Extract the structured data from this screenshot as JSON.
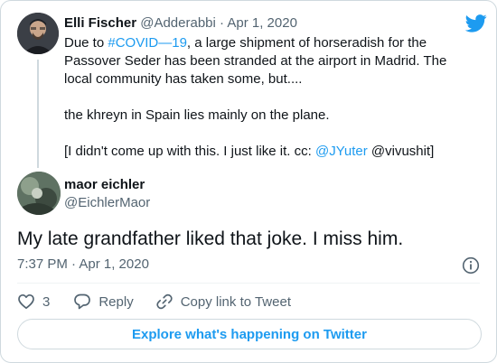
{
  "parent_tweet": {
    "author_name": "Elli Fischer",
    "author_handle": "@Adderabbi",
    "separator": "·",
    "date": "Apr 1, 2020",
    "line1_prefix": "Due to ",
    "hashtag": "#COVID—19",
    "line1_suffix": ", a large shipment of horseradish for the Passover Seder has been stranded at the airport in Madrid. The local community has taken some, but....",
    "paragraph2": "the khreyn in Spain lies mainly on the plane.",
    "paragraph3_prefix": "[I didn't come up with this. I just like it. cc: ",
    "mention": "@JYuter",
    "paragraph3_suffix": " @vivushit]"
  },
  "reply_tweet": {
    "author_name": "maor eichler",
    "author_handle": "@EichlerMaor",
    "text": "My late grandfather liked that joke. I miss him.",
    "timestamp": "7:37 PM · Apr 1, 2020"
  },
  "actions": {
    "like_count": "3",
    "reply_label": "Reply",
    "copy_link_label": "Copy link to Tweet"
  },
  "explore_label": "Explore what's happening on Twitter",
  "colors": {
    "accent": "#1d9bf0",
    "muted_text": "#536471",
    "border": "#cfd9de"
  },
  "icons": [
    "twitter-bird-icon",
    "info-icon",
    "heart-icon",
    "reply-bubble-icon",
    "link-icon"
  ]
}
